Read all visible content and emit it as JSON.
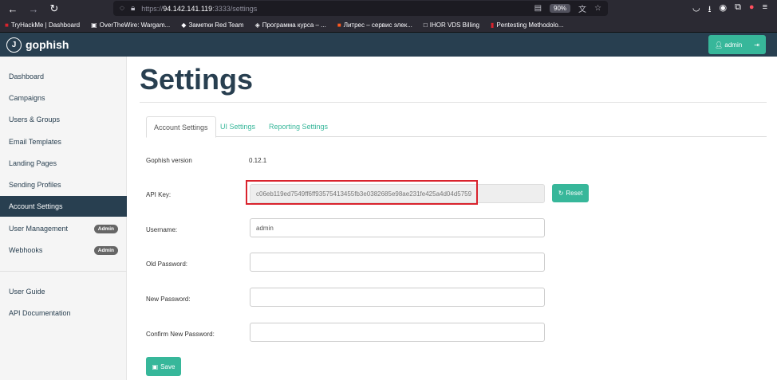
{
  "browser": {
    "url_host": "94.142.141.119",
    "url_port": ":3333/settings",
    "url_scheme": "https://",
    "zoom": "90%"
  },
  "bookmarks": [
    {
      "label": "TryHackMe | Dashboard",
      "icon": "tryhackme-icon"
    },
    {
      "label": "OverTheWire: Wargam...",
      "icon": "overthewire-icon"
    },
    {
      "label": "Заметки Red Team",
      "icon": "notes-icon"
    },
    {
      "label": "Программа курса – ...",
      "icon": "course-icon"
    },
    {
      "label": "Литрес – сервис элек...",
      "icon": "litres-icon"
    },
    {
      "label": "IHOR VDS Billing",
      "icon": "billing-icon"
    },
    {
      "label": "Pentesting Methodolo...",
      "icon": "pentest-icon"
    }
  ],
  "navbar": {
    "brand": "gophish",
    "admin_label": "admin"
  },
  "sidebar": {
    "items": [
      {
        "label": "Dashboard"
      },
      {
        "label": "Campaigns"
      },
      {
        "label": "Users & Groups"
      },
      {
        "label": "Email Templates"
      },
      {
        "label": "Landing Pages"
      },
      {
        "label": "Sending Profiles"
      },
      {
        "label": "Account Settings"
      },
      {
        "label": "User Management",
        "badge": "Admin"
      },
      {
        "label": "Webhooks",
        "badge": "Admin"
      },
      {
        "label": "User Guide"
      },
      {
        "label": "API Documentation"
      }
    ]
  },
  "page": {
    "title": "Settings",
    "tabs": [
      {
        "label": "Account Settings"
      },
      {
        "label": "UI Settings"
      },
      {
        "label": "Reporting Settings"
      }
    ],
    "version_label": "Gophish version",
    "version_value": "0.12.1",
    "api_key_label": "API Key:",
    "api_key_value": "c06eb119ed7549ff6ff93575413455fb3e0382685e98ae231fe425a4d04d5759",
    "reset_label": "Reset",
    "username_label": "Username:",
    "username_value": "admin",
    "old_password_label": "Old Password:",
    "new_password_label": "New Password:",
    "confirm_password_label": "Confirm New Password:",
    "save_label": "Save"
  },
  "colors": {
    "navbar": "#283f50",
    "accent": "#37b79a",
    "highlight": "#d9232d"
  }
}
